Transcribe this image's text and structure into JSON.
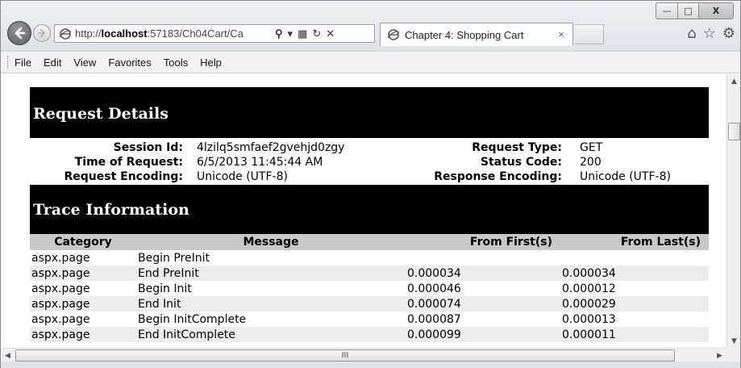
{
  "window": {
    "controls": {
      "minimize": "—",
      "maximize": "□",
      "close": "X"
    }
  },
  "browser": {
    "address": {
      "prefix": "http://",
      "host": "localhost",
      "rest": ":57183/Ch04Cart/Ca"
    },
    "address_tools": {
      "search": "⚲",
      "dropdown": "▾",
      "compat": "▦",
      "refresh": "↻",
      "stop": "✕"
    },
    "tab": {
      "title": "Chapter 4: Shopping Cart",
      "close": "×"
    },
    "right_icons": {
      "home": "⌂",
      "favorites": "☆",
      "tools": "⚙"
    }
  },
  "menu": [
    "File",
    "Edit",
    "View",
    "Favorites",
    "Tools",
    "Help"
  ],
  "request_details": {
    "heading": "Request Details",
    "left": [
      {
        "label": "Session Id:",
        "value": "4lzilq5smfaef2gvehjd0zgy"
      },
      {
        "label": "Time of Request:",
        "value": "6/5/2013 11:45:44 AM"
      },
      {
        "label": "Request Encoding:",
        "value": "Unicode (UTF-8)"
      }
    ],
    "right": [
      {
        "label": "Request Type:",
        "value": "GET"
      },
      {
        "label": "Status Code:",
        "value": "200"
      },
      {
        "label": "Response Encoding:",
        "value": "Unicode (UTF-8)"
      }
    ]
  },
  "trace": {
    "heading": "Trace Information",
    "columns": [
      "Category",
      "Message",
      "From First(s)",
      "From Last(s)"
    ],
    "rows": [
      [
        "aspx.page",
        "Begin PreInit",
        "",
        ""
      ],
      [
        "aspx.page",
        "End PreInit",
        "0.000034",
        "0.000034"
      ],
      [
        "aspx.page",
        "Begin Init",
        "0.000046",
        "0.000012"
      ],
      [
        "aspx.page",
        "End Init",
        "0.000074",
        "0.000029"
      ],
      [
        "aspx.page",
        "Begin InitComplete",
        "0.000087",
        "0.000013"
      ],
      [
        "aspx.page",
        "End InitComplete",
        "0.000099",
        "0.000011"
      ]
    ]
  },
  "scrollbar": {
    "h_thumb_grip": "III"
  }
}
